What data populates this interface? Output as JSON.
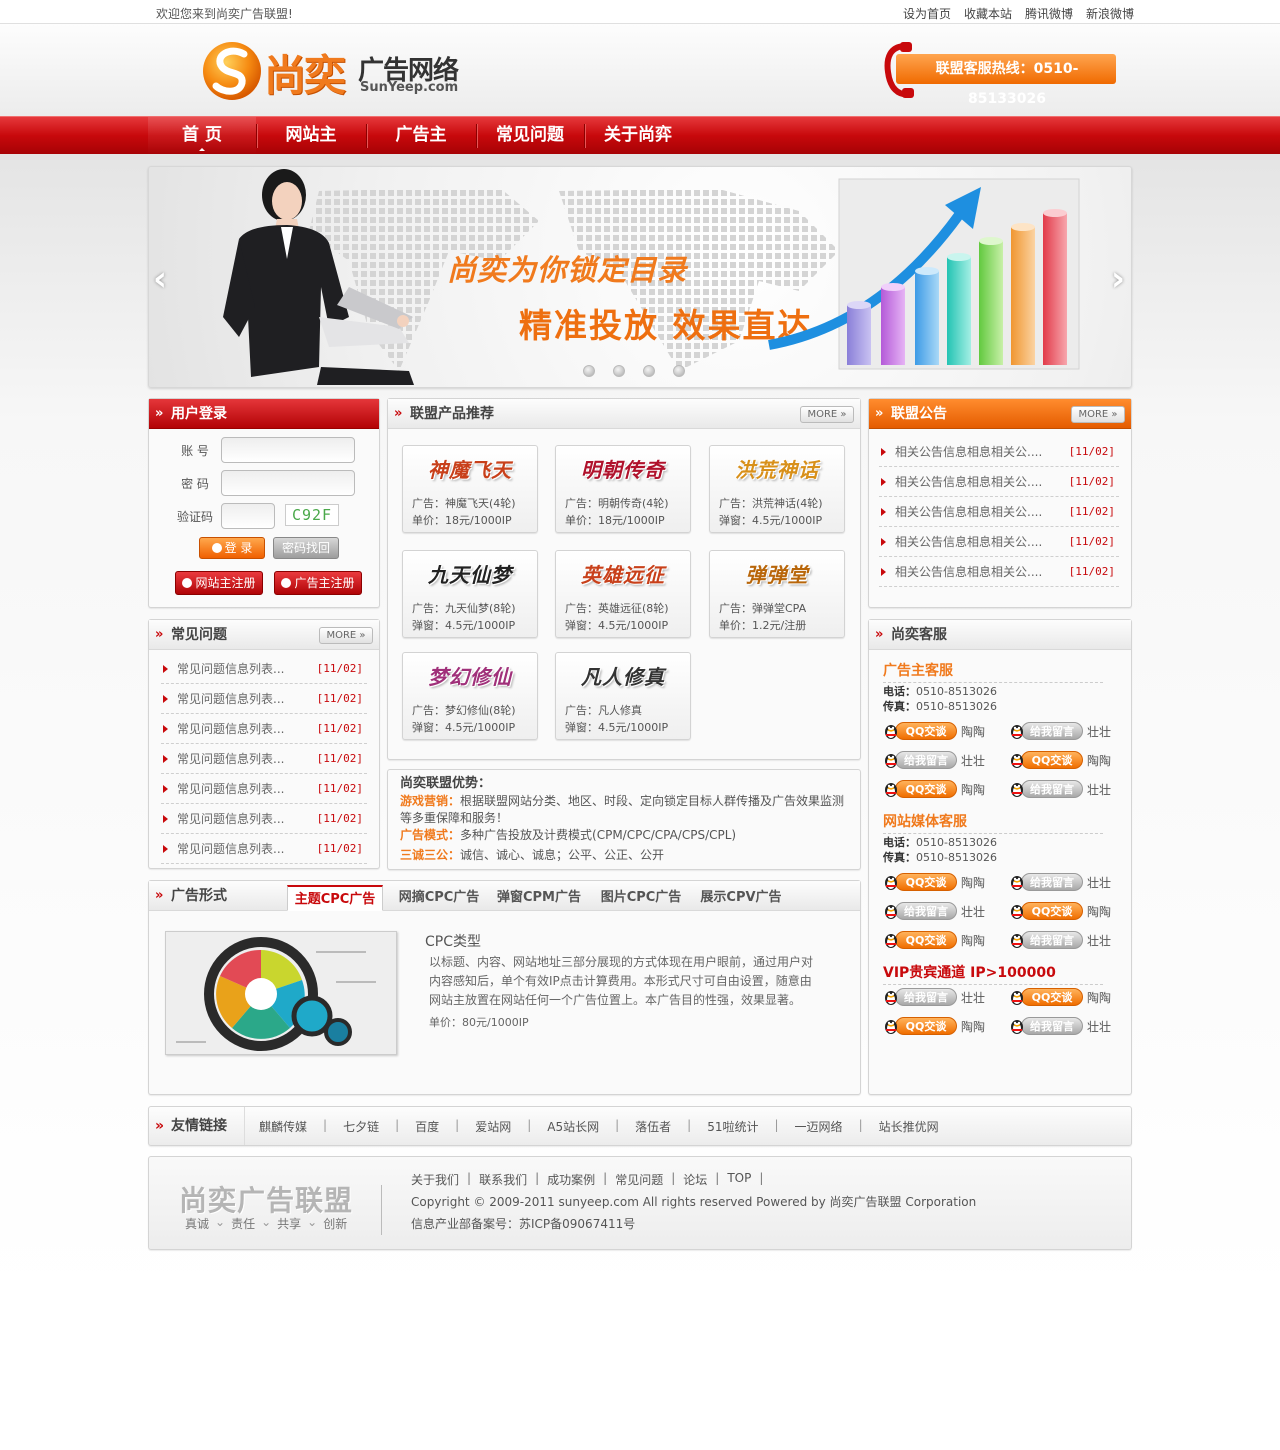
{
  "topbar": {
    "welcome": "欢迎您来到尚奕广告联盟!",
    "links": [
      "设为首页",
      "收藏本站",
      "腾讯微博",
      "新浪微博"
    ]
  },
  "header": {
    "logo_cn": "尚奕",
    "logo_cn2": "广告网络",
    "logo_en": "SunYeep.com",
    "hotline": "联盟客服热线：0510-85133026"
  },
  "nav": {
    "items": [
      "首 页",
      "网站主",
      "广告主",
      "常见问题",
      "关于尚弈"
    ],
    "active_index": 0
  },
  "banner": {
    "title1": "尚奕为你锁定目录",
    "title2": "精准投放  效果直达",
    "prev": "‹",
    "next": "›",
    "slide_count": 4
  },
  "login": {
    "title": "用户登录",
    "account_label": "账 号",
    "password_label": "密 码",
    "captcha_label": "验证码",
    "captcha_text": "C92F",
    "login_button": "登 录",
    "recover_button": "密码找回",
    "register_site": "网站主注册",
    "register_ad": "广告主注册"
  },
  "faq": {
    "title": "常见问题",
    "more": "MORE",
    "items": [
      {
        "text": "常见问题信息列表...",
        "date": "[11/02]"
      },
      {
        "text": "常见问题信息列表...",
        "date": "[11/02]"
      },
      {
        "text": "常见问题信息列表...",
        "date": "[11/02]"
      },
      {
        "text": "常见问题信息列表...",
        "date": "[11/02]"
      },
      {
        "text": "常见问题信息列表...",
        "date": "[11/02]"
      },
      {
        "text": "常见问题信息列表...",
        "date": "[11/02]"
      },
      {
        "text": "常见问题信息列表...",
        "date": "[11/02]"
      }
    ]
  },
  "products": {
    "title": "联盟产品推荐",
    "more": "MORE",
    "items": [
      {
        "logo": "神魔飞天",
        "line1": "广告：神魔飞天(4轮)",
        "line2": "单价：18元/1000IP",
        "color": "#c8401a"
      },
      {
        "logo": "明朝传奇",
        "line1": "广告：明朝传奇(4轮)",
        "line2": "单价：18元/1000IP",
        "color": "#b0122c"
      },
      {
        "logo": "洪荒神话",
        "line1": "广告：洪荒神话(4轮)",
        "line2": "弹窗：4.5元/1000IP",
        "color": "#d8901a"
      },
      {
        "logo": "九天仙梦",
        "line1": "广告：九天仙梦(8轮)",
        "line2": "弹窗：4.5元/1000IP",
        "color": "#222222"
      },
      {
        "logo": "英雄远征",
        "line1": "广告：英雄远征(8轮)",
        "line2": "弹窗：4.5元/1000IP",
        "color": "#c8401a"
      },
      {
        "logo": "弹弹堂",
        "line1": "广告：弹弹堂CPA",
        "line2": "单价：1.2元/注册",
        "color": "#b8660a"
      },
      {
        "logo": "梦幻修仙",
        "line1": "广告：梦幻修仙(8轮)",
        "line2": "弹窗：4.5元/1000IP",
        "color": "#a0307a"
      },
      {
        "logo": "凡人修真",
        "line1": "广告：凡人修真",
        "line2": "弹窗：4.5元/1000IP",
        "color": "#333333"
      }
    ]
  },
  "advantages": {
    "title": "尚奕联盟优势：",
    "lines": [
      {
        "label": "游戏营销：",
        "text": "根据联盟网站分类、地区、时段、定向锁定目标人群传播及广告效果监测"
      },
      {
        "label": "",
        "text": "等多重保障和服务！"
      },
      {
        "label": "广告模式：",
        "text": "多种广告投放及计费模式(CPM/CPC/CPA/CPS/CPL)"
      },
      {
        "label": "三诚三公：",
        "text": "诚信、诚心、诚息；公平、公正、公开"
      }
    ]
  },
  "ad_forms": {
    "title": "广告形式",
    "tabs": [
      "主题CPC广告",
      "网摘CPC广告",
      "弹窗CPM广告",
      "图片CPC广告",
      "展示CPV广告"
    ],
    "active_tab": 0,
    "content_title": "CPC类型",
    "content_lines": [
      "以标题、内容、网站地址三部分展现的方式体现在用户眼前，通过用户对",
      "内容感知后，单个有效IP点击计算费用。本形式尺寸可自由设置，随意由",
      "网站主放置在网站任何一个广告位置上。本广告目的性强，效果显著。"
    ],
    "price": "单价：80元/1000IP"
  },
  "notice": {
    "title": "联盟公告",
    "more": "MORE",
    "items": [
      {
        "text": "相关公告信息相息相关公....",
        "date": "[11/02]"
      },
      {
        "text": "相关公告信息相息相关公....",
        "date": "[11/02]"
      },
      {
        "text": "相关公告信息相息相关公....",
        "date": "[11/02]"
      },
      {
        "text": "相关公告信息相息相关公....",
        "date": "[11/02]"
      },
      {
        "text": "相关公告信息相息相关公....",
        "date": "[11/02]"
      }
    ]
  },
  "service": {
    "title": "尚奕客服",
    "phone_label": "电话：",
    "fax_label": "传真：",
    "groups": [
      {
        "heading": "广告主客服",
        "phone": "0510-8513026",
        "fax": "0510-8513026",
        "rows": [
          [
            {
              "btn": "QQ交谈",
              "type": "or",
              "name": "陶陶"
            },
            {
              "btn": "给我留言",
              "type": "gr",
              "name": "壮壮"
            }
          ],
          [
            {
              "btn": "给我留言",
              "type": "gr",
              "name": "壮壮"
            },
            {
              "btn": "QQ交谈",
              "type": "or",
              "name": "陶陶"
            }
          ],
          [
            {
              "btn": "QQ交谈",
              "type": "or",
              "name": "陶陶"
            },
            {
              "btn": "给我留言",
              "type": "gr",
              "name": "壮壮"
            }
          ]
        ]
      },
      {
        "heading": "网站媒体客服",
        "phone": "0510-8513026",
        "fax": "0510-8513026",
        "rows": [
          [
            {
              "btn": "QQ交谈",
              "type": "or",
              "name": "陶陶"
            },
            {
              "btn": "给我留言",
              "type": "gr",
              "name": "壮壮"
            }
          ],
          [
            {
              "btn": "给我留言",
              "type": "gr",
              "name": "壮壮"
            },
            {
              "btn": "QQ交谈",
              "type": "or",
              "name": "陶陶"
            }
          ],
          [
            {
              "btn": "QQ交谈",
              "type": "or",
              "name": "陶陶"
            },
            {
              "btn": "给我留言",
              "type": "gr",
              "name": "壮壮"
            }
          ]
        ]
      },
      {
        "heading": "VIP贵宾通道  IP>100000",
        "rows": [
          [
            {
              "btn": "给我留言",
              "type": "gr",
              "name": "壮壮"
            },
            {
              "btn": "QQ交谈",
              "type": "or",
              "name": "陶陶"
            }
          ],
          [
            {
              "btn": "QQ交谈",
              "type": "or",
              "name": "陶陶"
            },
            {
              "btn": "给我留言",
              "type": "gr",
              "name": "壮壮"
            }
          ]
        ]
      }
    ]
  },
  "friend_links": {
    "title": "友情链接",
    "items": [
      "麒麟传媒",
      "七夕链",
      "百度",
      "爱站网",
      "A5站长网",
      "落伍者",
      "51啦统计",
      "一迈网络",
      "站长推优网"
    ]
  },
  "footer": {
    "logo": "尚奕广告联盟",
    "slogan": [
      "真诚",
      "责任",
      "共享",
      "创新"
    ],
    "links": [
      "关于我们",
      "联系我们",
      "成功案例",
      "常见问题",
      "论坛",
      "TOP"
    ],
    "copyright": "Copyright © 2009-2011 sunyeep.com  All rights reserved Powered by 尚奕广告联盟 Corporation",
    "icp": "信息产业部备案号：苏ICP备09067411号"
  },
  "colors": {
    "brand_red": "#c8090c",
    "accent_orange": "#f07a1d"
  }
}
